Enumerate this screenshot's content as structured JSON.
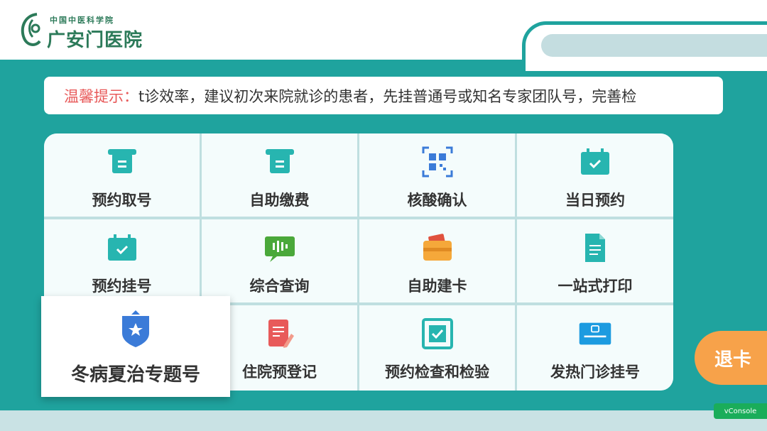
{
  "header": {
    "logo_subtitle": "中国中医科学院",
    "logo_title": "广安门医院"
  },
  "notice": {
    "label": "温馨提示：",
    "text": "t诊效率，建议初次来院就诊的患者，先挂普通号或知名专家团队号，完善检"
  },
  "menu": {
    "items": [
      {
        "label": "预约取号",
        "icon": "ticket-icon"
      },
      {
        "label": "自助缴费",
        "icon": "ticket-icon"
      },
      {
        "label": "核酸确认",
        "icon": "qrcode-icon"
      },
      {
        "label": "当日预约",
        "icon": "calendar-check-icon"
      },
      {
        "label": "预约挂号",
        "icon": "calendar-check-icon"
      },
      {
        "label": "综合查询",
        "icon": "chat-bubble-icon"
      },
      {
        "label": "自助建卡",
        "icon": "wallet-card-icon"
      },
      {
        "label": "一站式打印",
        "icon": "document-icon"
      },
      {
        "label": "冬病夏治专题号",
        "icon": "shield-star-icon"
      },
      {
        "label": "住院预登记",
        "icon": "edit-document-icon"
      },
      {
        "label": "预约检查和检验",
        "icon": "inspection-icon"
      },
      {
        "label": "发热门诊挂号",
        "icon": "fever-clinic-icon"
      }
    ]
  },
  "exit_button": {
    "label": "退卡"
  },
  "vconsole": {
    "label": "vConsole"
  },
  "colors": {
    "background": "#1fa39e",
    "accent_orange": "#f7a24a",
    "notice_label": "#e85a5a",
    "icon_teal": "#27b5b0"
  }
}
